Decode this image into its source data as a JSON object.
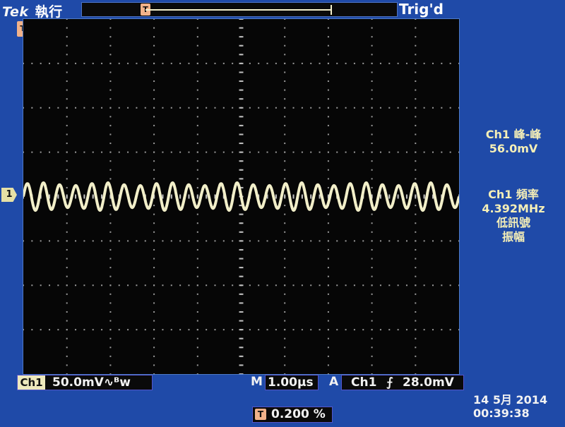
{
  "header": {
    "brand": "Tek",
    "run_status": "執行",
    "trigger_status": "Trig'd",
    "trigger_marker_icon": "T"
  },
  "channel": {
    "label": "1",
    "scale_tag": "Ch1",
    "scale_value": "50.0mV∿ᴮw"
  },
  "measurements": [
    {
      "label": "Ch1 峰-峰",
      "value": "56.0mV",
      "note": ""
    },
    {
      "label": "Ch1 頻率",
      "value": "4.392MHz",
      "note": "低訊號\n振幅"
    }
  ],
  "timebase": {
    "prefix": "M",
    "value": "1.00µs"
  },
  "trigger": {
    "prefix": "A",
    "source": "Ch1",
    "slope_icon": "rising-edge-icon",
    "slope_glyph": "⨍",
    "level": "28.0mV"
  },
  "position": {
    "icon": "T",
    "value": "0.200 %"
  },
  "datetime": {
    "date": "14 5月  2014",
    "time": "00:39:38"
  },
  "waveform": {
    "cycles": 27,
    "amplitude_div": 0.56,
    "center_div": 0.2,
    "color": "#f2efc9"
  },
  "colors": {
    "background": "#1f4aa8",
    "screen": "#060606",
    "trace": "#f2efc9",
    "readout": "#f5efb7",
    "marker": "#f1b28a"
  }
}
